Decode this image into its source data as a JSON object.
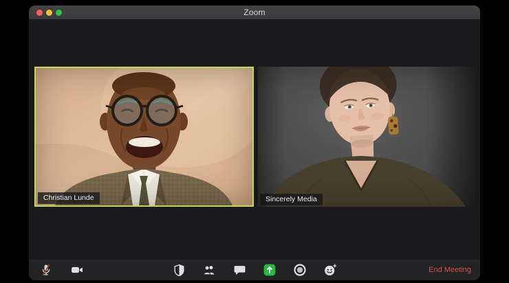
{
  "window": {
    "title": "Zoom"
  },
  "participants": [
    {
      "name": "Christian Lunde",
      "active_speaker": true
    },
    {
      "name": "Sincerely Media",
      "active_speaker": false
    }
  ],
  "toolbar": {
    "left_buttons": [
      {
        "icon": "microphone-muted-icon",
        "state": "muted"
      },
      {
        "icon": "video-camera-icon",
        "state": "on"
      }
    ],
    "center_buttons": [
      {
        "icon": "security-shield-icon"
      },
      {
        "icon": "participants-icon"
      },
      {
        "icon": "chat-bubble-icon"
      },
      {
        "icon": "share-screen-icon"
      },
      {
        "icon": "record-icon"
      },
      {
        "icon": "reactions-icon"
      }
    ],
    "end_meeting_label": "End Meeting"
  },
  "colors": {
    "desktop_bg": "#000000",
    "titlebar_bg": "#3b3b3d",
    "stage_bg": "#1a1a1c",
    "toolbar_bg": "#232325",
    "active_speaker_border": "#c3d84e",
    "end_meeting_red": "#d8504e",
    "share_screen_green": "#2bb741",
    "close_red": "#ff5f57",
    "minimize_yellow": "#febc2e",
    "fullscreen_green": "#28c840"
  }
}
